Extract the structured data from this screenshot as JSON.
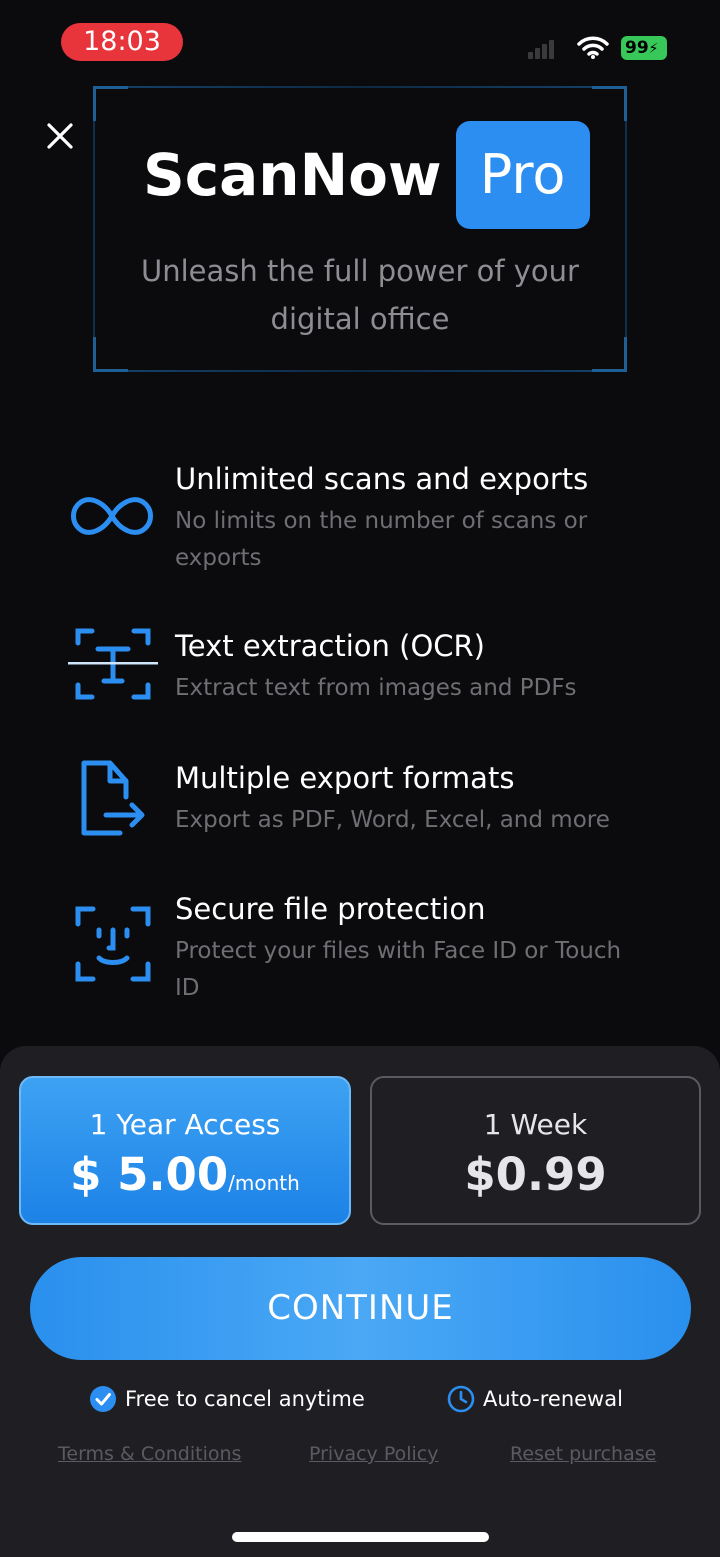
{
  "status_bar": {
    "time": "18:03",
    "battery": "99"
  },
  "hero": {
    "brand_name": "ScanNow",
    "badge": "Pro",
    "tagline": "Unleash the full power of your digital office"
  },
  "features": [
    {
      "icon": "infinity-icon",
      "title": "Unlimited scans and exports",
      "description": "No limits on the number of scans or exports"
    },
    {
      "icon": "text-scan-icon",
      "title": "Text extraction (OCR)",
      "description": "Extract text from images and PDFs"
    },
    {
      "icon": "export-file-icon",
      "title": "Multiple export formats",
      "description": "Export as PDF, Word, Excel, and more"
    },
    {
      "icon": "face-id-icon",
      "title": "Secure file protection",
      "description": "Protect your files with Face ID or Touch ID"
    }
  ],
  "plans": [
    {
      "label": "1 Year Access",
      "price": "$ 5.00",
      "unit": "/month",
      "selected": true
    },
    {
      "label": "1 Week",
      "price": "$0.99",
      "unit": "",
      "selected": false
    }
  ],
  "continue_label": "CONTINUE",
  "assurances": {
    "cancel": "Free to cancel anytime",
    "renewal": "Auto-renewal"
  },
  "links": {
    "terms": "Terms & Conditions",
    "privacy": "Privacy Policy",
    "reset": "Reset purchase"
  },
  "colors": {
    "accent": "#2b8ef0",
    "background": "#0b0b0d",
    "sheet": "#1f1f23",
    "recording": "#e8343b"
  }
}
